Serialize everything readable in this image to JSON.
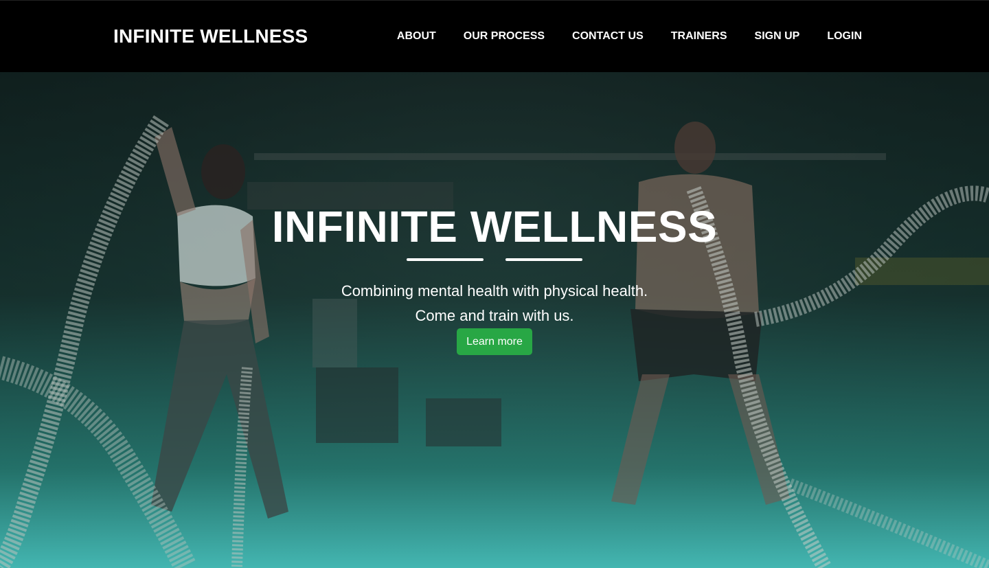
{
  "nav": {
    "brand": "INFINITE WELLNESS",
    "links": [
      "ABOUT",
      "OUR PROCESS",
      "CONTACT US",
      "TRAINERS",
      "SIGN UP",
      "LOGIN"
    ]
  },
  "hero": {
    "title": "INFINITE WELLNESS",
    "tagline_line1": "Combining mental health with physical health.",
    "tagline_line2": "Come and train with us.",
    "cta_label": "Learn more"
  },
  "colors": {
    "nav_bg": "#000000",
    "cta_bg": "#28a745",
    "hero_gradient_bottom": "#46beb9",
    "text": "#ffffff"
  }
}
